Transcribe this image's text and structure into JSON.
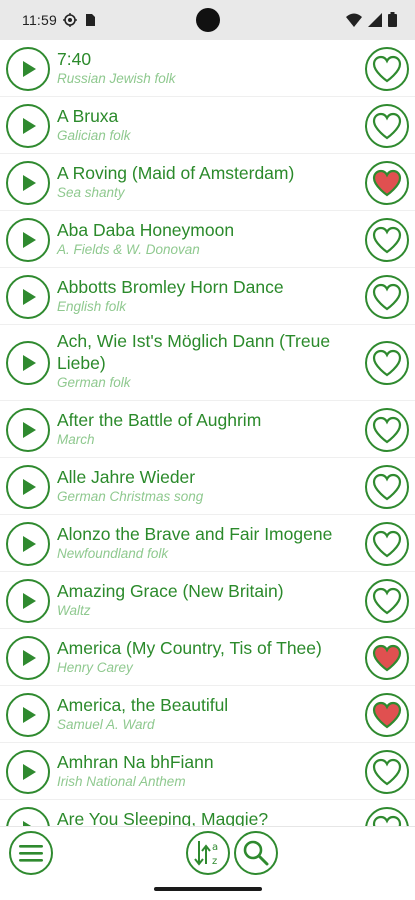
{
  "status": {
    "time": "11:59",
    "left_icons": [
      "location-icon",
      "sim-card-icon"
    ],
    "right_icons": [
      "wifi-icon",
      "signal-icon",
      "battery-icon"
    ]
  },
  "colors": {
    "accent": "#2f8a2f",
    "subtitle": "#8fc98f",
    "favorite_fill": "#e05050"
  },
  "songs": [
    {
      "title": "7:40",
      "subtitle": "Russian Jewish folk",
      "favorite": false
    },
    {
      "title": "A Bruxa",
      "subtitle": "Galician folk",
      "favorite": false
    },
    {
      "title": "A Roving (Maid of Amsterdam)",
      "subtitle": "Sea shanty",
      "favorite": true
    },
    {
      "title": "Aba Daba Honeymoon",
      "subtitle": "A. Fields & W. Donovan",
      "favorite": false
    },
    {
      "title": "Abbotts Bromley Horn Dance",
      "subtitle": "English folk",
      "favorite": false
    },
    {
      "title": "Ach, Wie Ist's Möglich Dann (Treue Liebe)",
      "subtitle": "German folk",
      "favorite": false
    },
    {
      "title": "After the Battle of Aughrim",
      "subtitle": "March",
      "favorite": false
    },
    {
      "title": "Alle Jahre Wieder",
      "subtitle": "German Christmas song",
      "favorite": false
    },
    {
      "title": "Alonzo the Brave and Fair Imogene",
      "subtitle": "Newfoundland folk",
      "favorite": false
    },
    {
      "title": "Amazing Grace (New Britain)",
      "subtitle": "Waltz",
      "favorite": false
    },
    {
      "title": "America (My Country, Tis of Thee)",
      "subtitle": "Henry Carey",
      "favorite": true
    },
    {
      "title": "America, the Beautiful",
      "subtitle": "Samuel A. Ward",
      "favorite": true
    },
    {
      "title": "Amhran Na bhFiann",
      "subtitle": "Irish National Anthem",
      "favorite": false
    },
    {
      "title": "Are You Sleeping, Maggie?",
      "subtitle": "",
      "favorite": false
    }
  ],
  "toolbar": {
    "menu_icon": "hamburger-menu-icon",
    "sort_icon": "sort-az-icon",
    "search_icon": "search-icon"
  }
}
